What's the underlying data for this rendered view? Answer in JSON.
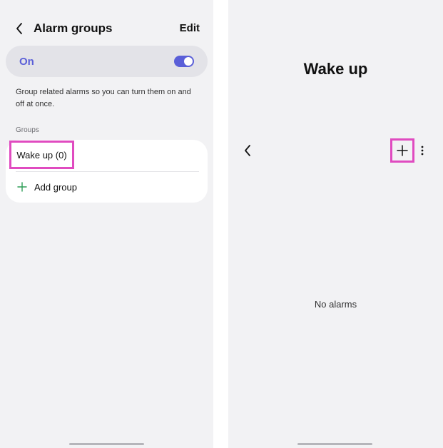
{
  "left_screen": {
    "header": {
      "title": "Alarm groups",
      "edit_label": "Edit"
    },
    "master_toggle": {
      "label": "On",
      "state": true
    },
    "description": "Group related alarms so you can turn them on and off at once.",
    "groups_section_label": "Groups",
    "groups": [
      {
        "label": "Wake up (0)"
      }
    ],
    "add_group_label": "Add group"
  },
  "right_screen": {
    "title": "Wake up",
    "empty_state": "No alarms"
  },
  "icons": {
    "back": "chevron-left-icon",
    "add": "plus-icon",
    "more": "more-vertical-icon"
  },
  "colors": {
    "accent": "#5a5fd8",
    "highlight": "#e04bc0",
    "add_icon_green": "#2f9e57",
    "background": "#f2f2f4"
  }
}
